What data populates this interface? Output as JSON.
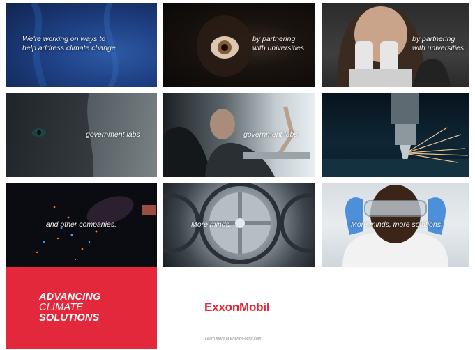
{
  "tiles": [
    {
      "caption_line1": "We're working on ways to",
      "caption_line2": "help address climate change"
    },
    {
      "caption_line1": "by partnering",
      "caption_line2": "with universities"
    },
    {
      "caption_line1": "by partnering",
      "caption_line2": "with universities"
    },
    {
      "caption_line1": "government labs"
    },
    {
      "caption_line1": "government labs"
    },
    {
      "caption_line1": ""
    },
    {
      "caption_line1": "and other companies."
    },
    {
      "caption_line1": "More minds,"
    },
    {
      "caption_line1": "More minds, more solutions."
    }
  ],
  "campaign": {
    "line1": "ADVANCING",
    "line2": "CLIMATE",
    "line3": "SOLUTIONS"
  },
  "brand": {
    "logo_text": "ExxonMobil",
    "learn_more": "Learn more at EnergyFactor.com"
  },
  "colors": {
    "brand_red": "#e3283b"
  }
}
